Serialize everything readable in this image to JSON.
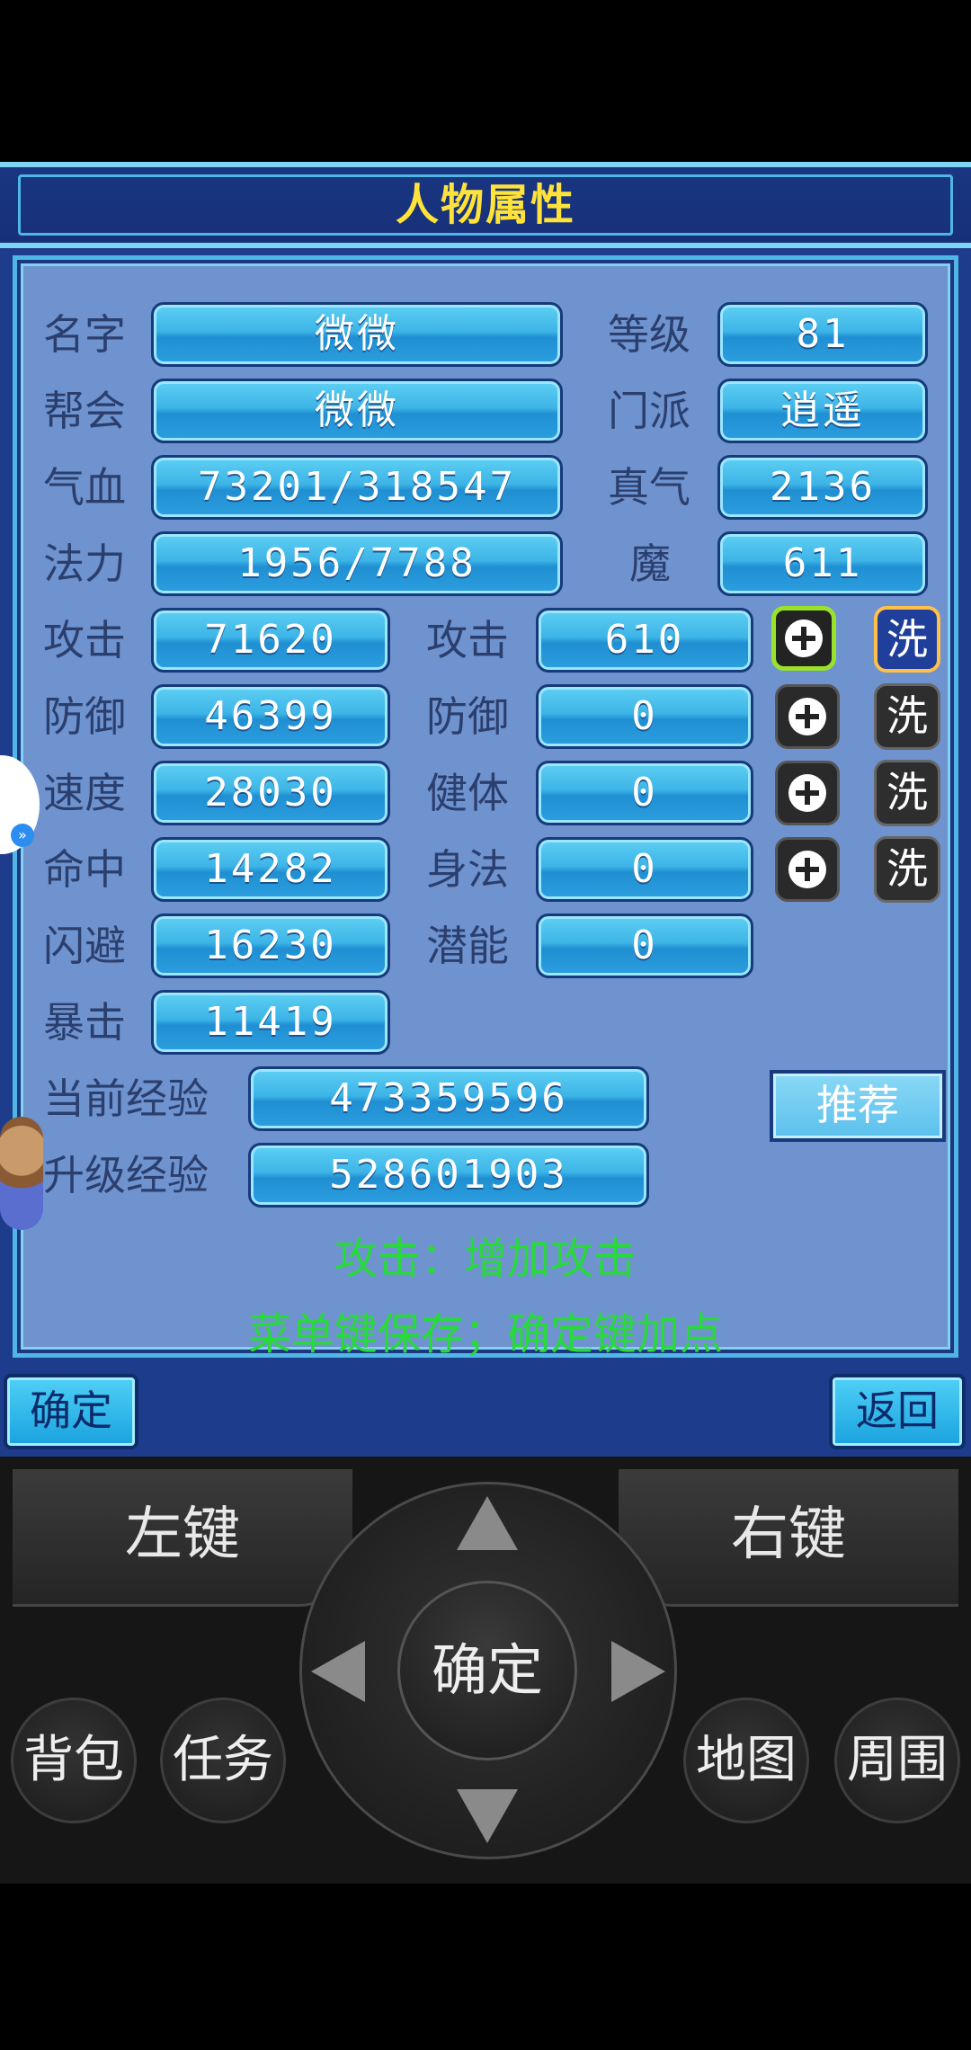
{
  "window": {
    "title": "人物属性"
  },
  "top_fields": [
    {
      "label": "名字",
      "value": "微微"
    },
    {
      "label": "帮会",
      "value": "微微"
    },
    {
      "label": "气血",
      "value": "73201/318547"
    },
    {
      "label": "法力",
      "value": "1956/7788"
    }
  ],
  "right_fields": [
    {
      "label": "等级",
      "value": "81"
    },
    {
      "label": "门派",
      "value": "逍遥"
    },
    {
      "label": "真气",
      "value": "2136"
    },
    {
      "label": "魔",
      "value": "611"
    }
  ],
  "stats": [
    {
      "label": "攻击",
      "value": "71620"
    },
    {
      "label": "防御",
      "value": "46399"
    },
    {
      "label": "速度",
      "value": "28030"
    },
    {
      "label": "命中",
      "value": "14282"
    },
    {
      "label": "闪避",
      "value": "16230"
    },
    {
      "label": "暴击",
      "value": "11419"
    }
  ],
  "allocations": [
    {
      "label": "攻击",
      "value": "610"
    },
    {
      "label": "防御",
      "value": "0"
    },
    {
      "label": "健体",
      "value": "0"
    },
    {
      "label": "身法",
      "value": "0"
    },
    {
      "label": "潜能",
      "value": "0"
    }
  ],
  "wash_label": "洗",
  "recommend_label": "推荐",
  "experience": {
    "current_label": "当前经验",
    "current_value": "473359596",
    "levelup_label": "升级经验",
    "levelup_value": "528601903"
  },
  "hints": {
    "line1": "攻击：增加攻击",
    "line2": "菜单键保存；确定键加点"
  },
  "softkeys": {
    "confirm": "确定",
    "back": "返回"
  },
  "keypad": {
    "left_key": "左键",
    "right_key": "右键",
    "ok": "确定",
    "bag": "背包",
    "quest": "任务",
    "map": "地图",
    "nearby": "周围"
  },
  "colors": {
    "title": "#ffe23a",
    "hint": "#28d93a",
    "panel": "#6f93cf",
    "field": "#3cb4e6",
    "selected_outline": "#9ae22a"
  }
}
